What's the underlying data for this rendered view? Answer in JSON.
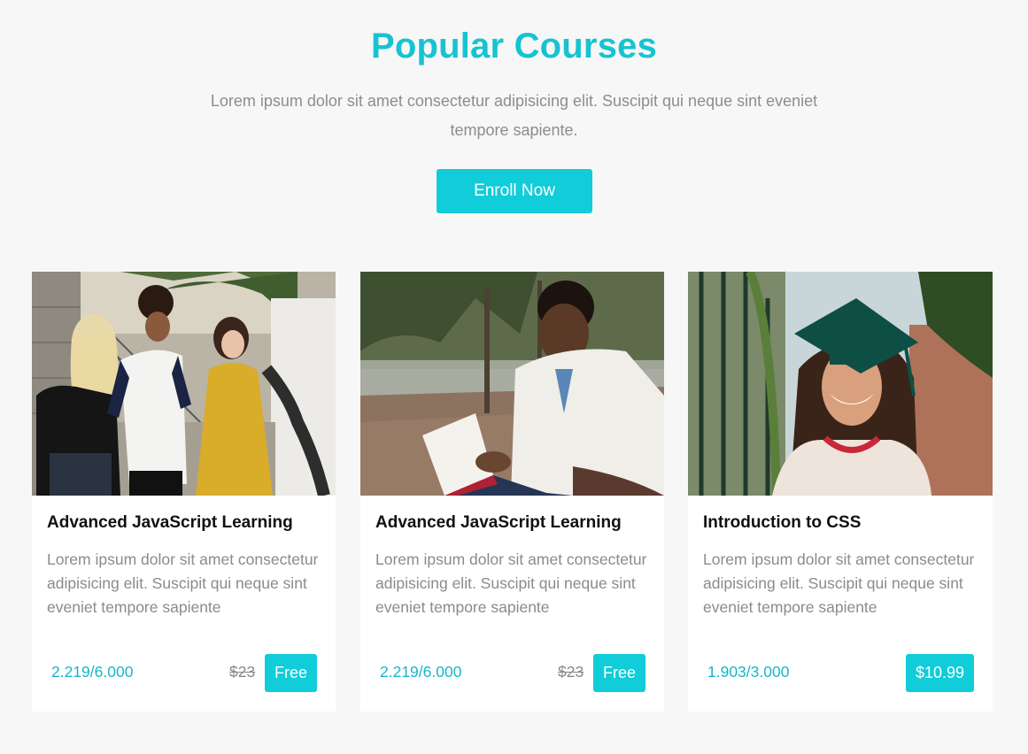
{
  "header": {
    "title": "Popular Courses",
    "subtitle": "Lorem ipsum dolor sit amet consectetur adipisicing elit. Suscipit qui neque sint eveniet tempore sapiente.",
    "enroll_label": "Enroll Now"
  },
  "colors": {
    "accent": "#11ccd9",
    "title": "#17c3d1",
    "stats": "#17b6c6",
    "muted_text": "#8b8b8b",
    "background": "#f7f7f7"
  },
  "courses": [
    {
      "title": "Advanced JavaScript Learning",
      "description": "Lorem ipsum dolor sit amet consectetur adipisicing elit. Suscipit qui neque sint eveniet tempore sapiente",
      "stats": "2.219/6.000",
      "old_price": "$23",
      "price": "Free",
      "image": "students-chatting-photo"
    },
    {
      "title": "Advanced JavaScript Learning",
      "description": "Lorem ipsum dolor sit amet consectetur adipisicing elit. Suscipit qui neque sint eveniet tempore sapiente",
      "stats": "2.219/6.000",
      "old_price": "$23",
      "price": "Free",
      "image": "man-reading-book-photo"
    },
    {
      "title": "Introduction to CSS",
      "description": "Lorem ipsum dolor sit amet consectetur adipisicing elit. Suscipit qui neque sint eveniet tempore sapiente",
      "stats": "1.903/3.000",
      "old_price": "",
      "price": "$10.99",
      "image": "graduate-smiling-photo"
    }
  ]
}
